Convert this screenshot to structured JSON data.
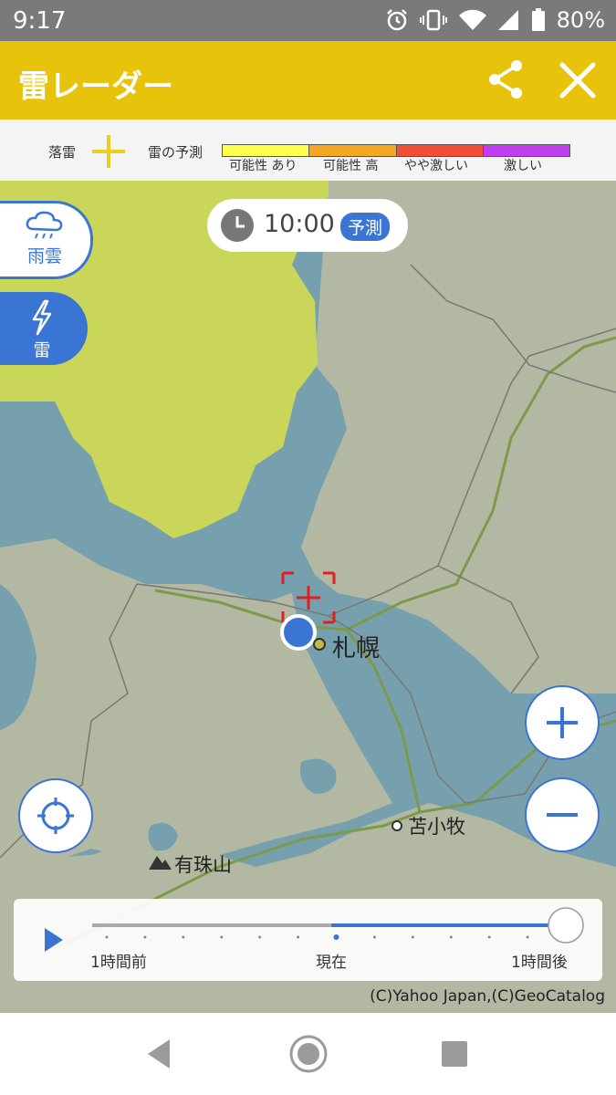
{
  "status_bar": {
    "time": "9:17",
    "battery": "80%"
  },
  "app_bar": {
    "title": "雷レーダー",
    "share_icon": "share-icon",
    "close_icon": "close-icon"
  },
  "legend": {
    "strike_label": "落雷",
    "forecast_label": "雷の予測",
    "levels": [
      {
        "label": "可能性 あり",
        "color": "#ffff4d"
      },
      {
        "label": "可能性 高",
        "color": "#f5a623"
      },
      {
        "label": "やや激しい",
        "color": "#f04e37"
      },
      {
        "label": "激しい",
        "color": "#c13ff0"
      }
    ]
  },
  "layers": [
    {
      "label": "雨雲",
      "icon": "rain-cloud-icon",
      "active": false
    },
    {
      "label": "雷",
      "icon": "lightning-icon",
      "active": true
    }
  ],
  "time_display": {
    "time": "10:00",
    "badge": "予測"
  },
  "map": {
    "places": [
      {
        "name": "札幌"
      },
      {
        "name": "苫小牧"
      },
      {
        "name": "有珠山"
      }
    ],
    "thunder_area_color": "#c9d65a",
    "water_color": "#77a0ae",
    "land_color": "#b3b8a3"
  },
  "timeline": {
    "labels": {
      "start": "1時間前",
      "now": "現在",
      "end": "1時間後"
    },
    "position": 1.0
  },
  "copyright": "(C)Yahoo Japan,(C)GeoCatalog"
}
